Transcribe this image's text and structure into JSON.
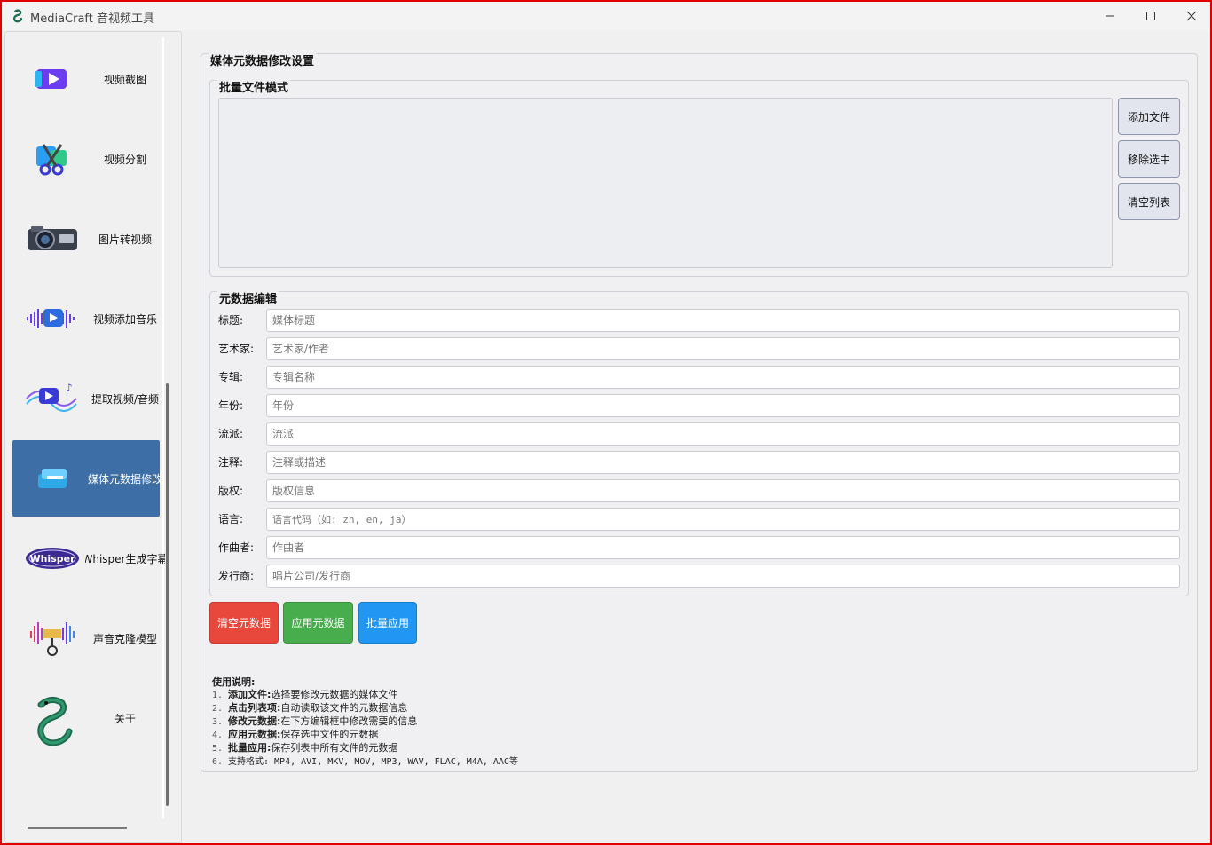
{
  "window": {
    "title": "MediaCraft 音视频工具",
    "controls": {
      "minimize": "—",
      "maximize": "☐",
      "close": "✕"
    }
  },
  "sidebar": {
    "items": [
      {
        "label": "视频截图",
        "icon": "video-capture-icon",
        "active": false
      },
      {
        "label": "视频分割",
        "icon": "video-split-icon",
        "active": false
      },
      {
        "label": "图片转视频",
        "icon": "camera-icon",
        "active": false
      },
      {
        "label": "视频添加音乐",
        "icon": "audio-wave-icon",
        "active": false
      },
      {
        "label": "提取视频/音频",
        "icon": "extract-audio-icon",
        "active": false
      },
      {
        "label": "媒体元数据修改",
        "icon": "metadata-box-icon",
        "active": true
      },
      {
        "label": "Whisper生成字幕",
        "icon": "whisper-logo-icon",
        "active": false
      },
      {
        "label": "声音克隆模型",
        "icon": "voice-clone-icon",
        "active": false
      },
      {
        "label": "关于",
        "icon": "snake-logo-icon",
        "active": false
      }
    ]
  },
  "main": {
    "group_title": "媒体元数据修改设置",
    "batch": {
      "title": "批量文件模式",
      "buttons": {
        "add": "添加文件",
        "remove": "移除选中",
        "clear": "清空列表"
      }
    },
    "meta": {
      "title": "元数据编辑",
      "fields": [
        {
          "label": "标题:",
          "placeholder": "媒体标题",
          "value": ""
        },
        {
          "label": "艺术家:",
          "placeholder": "艺术家/作者",
          "value": ""
        },
        {
          "label": "专辑:",
          "placeholder": "专辑名称",
          "value": ""
        },
        {
          "label": "年份:",
          "placeholder": "年份",
          "value": ""
        },
        {
          "label": "流派:",
          "placeholder": "流派",
          "value": ""
        },
        {
          "label": "注释:",
          "placeholder": "注释或描述",
          "value": ""
        },
        {
          "label": "版权:",
          "placeholder": "版权信息",
          "value": ""
        },
        {
          "label": "语言:",
          "placeholder": "语言代码（如: zh, en, ja）",
          "value": ""
        },
        {
          "label": "作曲者:",
          "placeholder": "作曲者",
          "value": ""
        },
        {
          "label": "发行商:",
          "placeholder": "唱片公司/发行商",
          "value": ""
        }
      ]
    },
    "actions": {
      "clear": "清空元数据",
      "apply": "应用元数据",
      "batch": "批量应用"
    },
    "usage": {
      "title": "使用说明:",
      "items": [
        {
          "num": "1.",
          "bold": "添加文件:",
          "text": "选择要修改元数据的媒体文件"
        },
        {
          "num": "2.",
          "bold": "点击列表项:",
          "text": "自动读取该文件的元数据信息"
        },
        {
          "num": "3.",
          "bold": "修改元数据:",
          "text": "在下方编辑框中修改需要的信息"
        },
        {
          "num": "4.",
          "bold": "应用元数据:",
          "text": "保存选中文件的元数据"
        },
        {
          "num": "5.",
          "bold": "批量应用:",
          "text": "保存列表中所有文件的元数据"
        },
        {
          "num": "6.",
          "bold": "",
          "text": "支持格式: MP4, AVI, MKV, MOV, MP3, WAV, FLAC, M4A, AAC等"
        }
      ]
    }
  },
  "colors": {
    "active_nav": "#3d6fa6",
    "btn_clear": "#e8473b",
    "btn_apply": "#48ad4c",
    "btn_batch": "#2196f3",
    "window_border": "#e00000"
  }
}
